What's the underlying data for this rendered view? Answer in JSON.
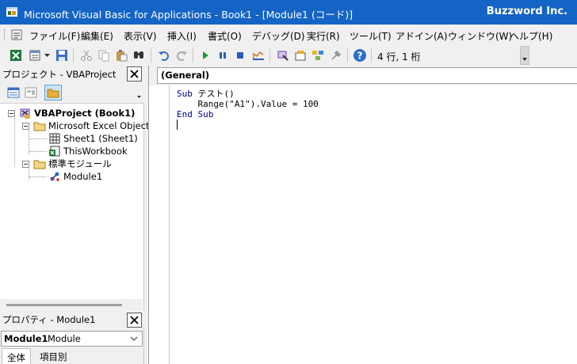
{
  "window": {
    "title": "Microsoft Visual Basic for Applications - Book1 - [Module1 (コード)]",
    "brand": "Buzzword Inc."
  },
  "menubar": {
    "items": [
      "ファイル(F)",
      "編集(E)",
      "表示(V)",
      "挿入(I)",
      "書式(O)",
      "デバッグ(D)",
      "実行(R)",
      "ツール(T)",
      "アドイン(A)",
      "ウィンドウ(W)",
      "ヘルプ(H)"
    ]
  },
  "toolbar": {
    "status": "4 行, 1 桁",
    "icons": [
      "excel-view-icon",
      "insert-module-icon",
      "save-icon",
      "cut-icon",
      "copy-icon",
      "paste-icon",
      "find-icon",
      "undo-icon",
      "redo-icon",
      "run-icon",
      "break-icon",
      "reset-icon",
      "design-mode-icon",
      "project-explorer-icon",
      "properties-icon",
      "object-browser-icon",
      "toolbox-icon",
      "help-icon"
    ]
  },
  "project_pane": {
    "title": "プロジェクト - VBAProject",
    "tree": [
      {
        "label": "VBAProject (Book1)",
        "bold": true,
        "icon": "vbaproject-icon"
      },
      {
        "label": "Microsoft Excel Objects",
        "icon": "folder-icon"
      },
      {
        "label": "Sheet1 (Sheet1)",
        "icon": "sheet-icon"
      },
      {
        "label": "ThisWorkbook",
        "icon": "workbook-icon"
      },
      {
        "label": "標準モジュール",
        "icon": "folder-icon"
      },
      {
        "label": "Module1",
        "icon": "module-icon"
      }
    ]
  },
  "properties_pane": {
    "title": "プロパティ - Module1",
    "object_name": "Module1",
    "object_type": "Module",
    "tabs": [
      "全体",
      "項目別"
    ],
    "active_tab": "全体"
  },
  "code_window": {
    "object_combo": "(General)",
    "lines": [
      {
        "kw1": "Sub",
        "rest": " テスト()"
      },
      {
        "kw1": "",
        "rest": "    Range(\"A1\").Value = 100"
      },
      {
        "kw1": "End Sub",
        "rest": ""
      }
    ]
  },
  "colors": {
    "titlebar": "#1464c6",
    "keyword": "#00008b",
    "chrome": "#f0f0f0"
  }
}
